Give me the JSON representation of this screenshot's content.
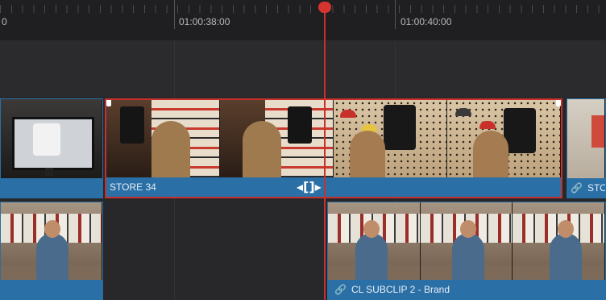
{
  "ruler": {
    "labels": [
      "0",
      "01:00:38:00",
      "01:00:40:00"
    ]
  },
  "clips": {
    "monitor_clip": {
      "name": ""
    },
    "store34": {
      "name": "STORE 34"
    },
    "store_right": {
      "name": "STO"
    },
    "interview_left": {
      "name": ""
    },
    "subclip": {
      "name": "CL SUBCLIP 2 - Brand"
    }
  },
  "icons": {
    "trim": "trim-handle-icon",
    "link": "link-icon",
    "playhead": "playhead-marker-icon"
  },
  "colors": {
    "clip": "#2a6fa6",
    "selection": "#c7302c",
    "playhead": "#d6352f",
    "background": "#28282b"
  }
}
